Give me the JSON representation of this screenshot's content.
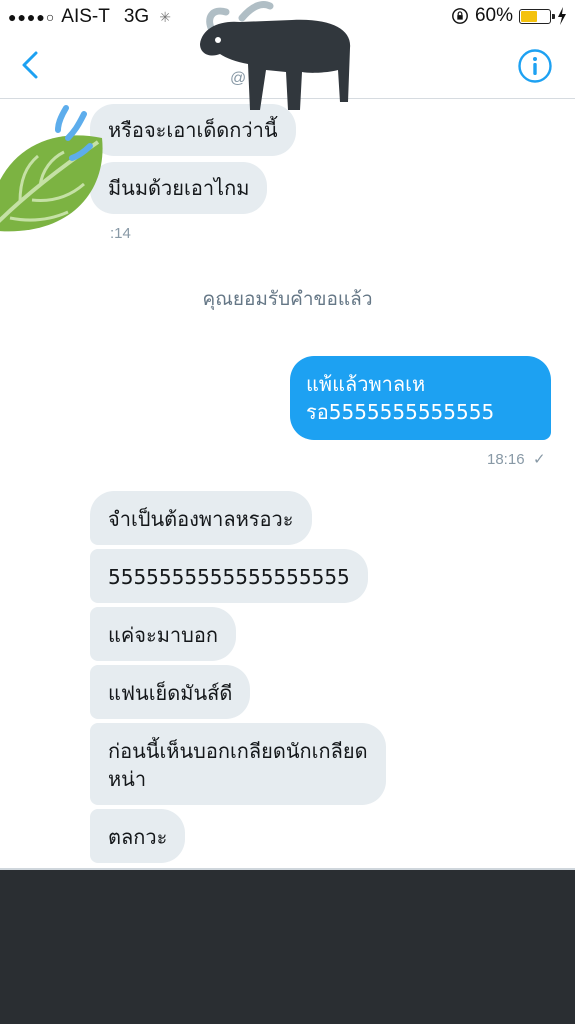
{
  "status_bar": {
    "signal_dots": "●●●●○",
    "carrier": "AIS-T",
    "network": "3G",
    "battery_percent": "60%",
    "battery_level": 0.6
  },
  "header": {
    "handle": "@"
  },
  "messages": {
    "m1": "หรือจะเอาเด็ดกว่านี้",
    "m2": "มีนมด้วยเอาไกม",
    "m2_time": ":14",
    "system": "คุณยอมรับคำขอแล้ว",
    "out1": "แพ้แล้วพาลเห\nรอ5555555555555",
    "out1_time": "18:16",
    "out1_check": "✓",
    "in3": "จำเป็นต้องพาลหรอวะ",
    "in4": "5555555555555555555",
    "in5": "แค่จะมาบอก",
    "in6": "แฟนเย็ดมันส์ดี",
    "in7": "ก่อนนี้เห็นบอกเกลียดนักเกลียด\nหน่า",
    "in8": "ตลกวะ"
  },
  "colors": {
    "accent": "#1da1f2",
    "incoming_bubble": "#e6ecf0",
    "bottom_block": "#2a2e32"
  },
  "icons": {
    "back": "chevron-left-icon",
    "info": "info-icon",
    "lock": "orientation-lock-icon",
    "charge": "charging-bolt-icon"
  }
}
